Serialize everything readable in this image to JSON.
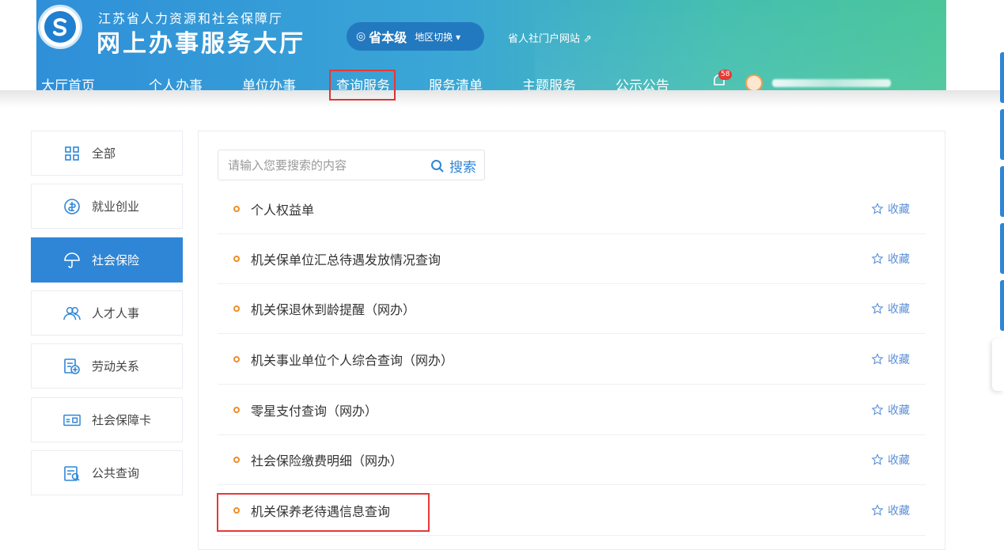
{
  "header": {
    "dept_name": "江苏省人力资源和社会保障厅",
    "site_name": "网上办事服务大厅",
    "region_level": "省本级",
    "region_switch": "地区切换 ▾",
    "portal_link": "省人社门户网站",
    "notification_count": "58",
    "nav": [
      "大厅首页",
      "个人办事",
      "单位办事",
      "查询服务",
      "服务清单",
      "主题服务",
      "公示公告"
    ],
    "active_nav": "查询服务"
  },
  "sidebar": {
    "items": [
      {
        "label": "全部",
        "icon": "grid-icon"
      },
      {
        "label": "就业创业",
        "icon": "employment-icon"
      },
      {
        "label": "社会保险",
        "icon": "umbrella-icon",
        "active": true
      },
      {
        "label": "人才人事",
        "icon": "people-icon"
      },
      {
        "label": "劳动关系",
        "icon": "document-add-icon"
      },
      {
        "label": "社会保障卡",
        "icon": "card-icon"
      },
      {
        "label": "公共查询",
        "icon": "query-list-icon"
      }
    ]
  },
  "search": {
    "placeholder": "请输入您要搜索的内容",
    "button_label": "搜索"
  },
  "services": [
    {
      "title": "个人权益单",
      "fav": "收藏"
    },
    {
      "title": "机关保单位汇总待遇发放情况查询",
      "fav": "收藏"
    },
    {
      "title": "机关保退休到龄提醒（网办）",
      "fav": "收藏"
    },
    {
      "title": "机关事业单位个人综合查询（网办）",
      "fav": "收藏"
    },
    {
      "title": "零星支付查询（网办）",
      "fav": "收藏"
    },
    {
      "title": "社会保险缴费明细（网办）",
      "fav": "收藏"
    },
    {
      "title": "机关保养老待遇信息查询",
      "fav": "收藏",
      "highlighted": true
    }
  ],
  "colors": {
    "primary": "#2f86d6",
    "highlight_border": "#e53935",
    "bullet": "#f08c2a"
  }
}
